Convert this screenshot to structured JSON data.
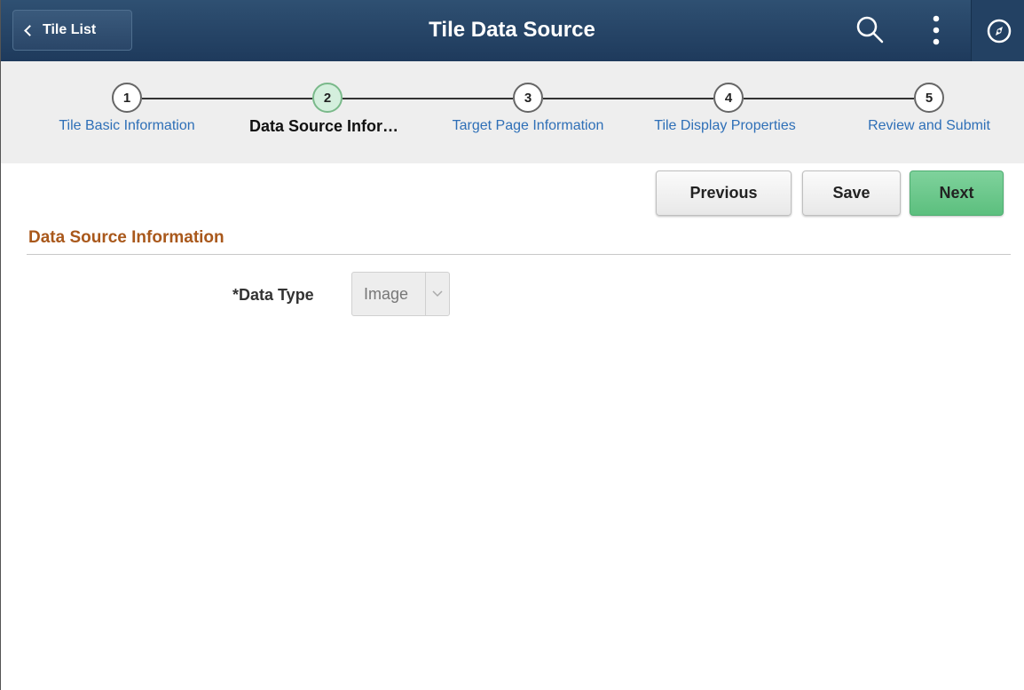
{
  "header": {
    "back_label": "Tile List",
    "title": "Tile Data Source",
    "icons": [
      "search-icon",
      "more-actions-icon",
      "navbar-compass-icon"
    ]
  },
  "train": {
    "steps": [
      {
        "number": "1",
        "label": "Tile Basic Information",
        "active": false
      },
      {
        "number": "2",
        "label": "Data Source Infor…",
        "active": true
      },
      {
        "number": "3",
        "label": "Target Page Information",
        "active": false
      },
      {
        "number": "4",
        "label": "Tile Display Properties",
        "active": false
      },
      {
        "number": "5",
        "label": "Review and Submit",
        "active": false
      }
    ]
  },
  "actions": {
    "previous_label": "Previous",
    "save_label": "Save",
    "next_label": "Next"
  },
  "section": {
    "title": "Data Source Information"
  },
  "form": {
    "data_type_label": "*Data Type",
    "data_type_value": "Image"
  },
  "colors": {
    "header_bg": "#1e3a5c",
    "link": "#2e6fb7",
    "section_title": "#a9581b",
    "next_button": "#5cbf7e",
    "active_step": "#d4efdd"
  }
}
